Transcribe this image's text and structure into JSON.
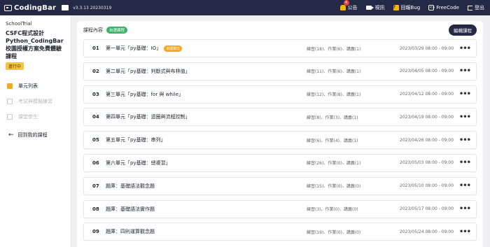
{
  "header": {
    "brand": "CodingBar",
    "version": "v3.3.13 20230319",
    "nav": [
      {
        "label": "公告",
        "badge": "4"
      },
      {
        "label": "視訊"
      },
      {
        "label": "回報Bug"
      },
      {
        "label": "FreeCode"
      },
      {
        "label": "登出"
      }
    ]
  },
  "sidebar": {
    "school": "SchoolTrial",
    "course_title": "CSFC程式設計Python_CodingBar校園授權方案免費體驗課程",
    "status": "進行中",
    "items": [
      {
        "label": "單元列表"
      },
      {
        "label": "考試與模擬練習"
      },
      {
        "label": "課堂學生"
      }
    ],
    "back_label": "回到我的課程"
  },
  "main": {
    "title": "課程內容",
    "mode_tag": "自選課程",
    "edit_label": "編輯課程",
    "units": [
      {
        "num": "01",
        "name": "第一單元「py基礎：IO」",
        "hint": "未開單元",
        "counts": "練習(18)、作業(6)、講義(1)",
        "date": "2023/03/29 08:00 - 09:00"
      },
      {
        "num": "02",
        "name": "第二單元「py基礎：判斷式與布林值」",
        "counts": "練習(11)、作業(6)、講義(1)",
        "date": "2023/04/05 08:00 - 09:00"
      },
      {
        "num": "03",
        "name": "第三單元「py基礎：for 與 while」",
        "counts": "練習(12)、作業(8)、講義(1)",
        "date": "2023/04/12 08:00 - 09:00"
      },
      {
        "num": "04",
        "name": "第四單元「py基礎：迴圈與流程控制」",
        "counts": "練習(8)、作業(3)、講義(1)",
        "date": "2023/04/19 08:00 - 09:00"
      },
      {
        "num": "05",
        "name": "第五單元「py基礎：串列」",
        "counts": "練習(6)、作業(4)、講義(1)",
        "date": "2023/04/26 08:00 - 09:00"
      },
      {
        "num": "06",
        "name": "第六單元「py基礎：總複習」",
        "counts": "練習(26)、作業(0)、講義(1)",
        "date": "2023/05/03 08:00 - 09:00"
      },
      {
        "num": "07",
        "name": "題庫：基礎語法觀念題",
        "counts": "練習(15)、作業(0)、講義(0)",
        "date": "2023/05/10 08:00 - 09:00"
      },
      {
        "num": "08",
        "name": "題庫：基礎語法實作題",
        "counts": "練習(3)、作業(0)、講義(0)",
        "date": "2023/05/17 08:00 - 09:00"
      },
      {
        "num": "09",
        "name": "題庫：四則運算觀念題",
        "counts": "練習(19)、作業(0)、講義(0)",
        "date": "2023/05/24 08:00 - 09:00"
      }
    ]
  }
}
